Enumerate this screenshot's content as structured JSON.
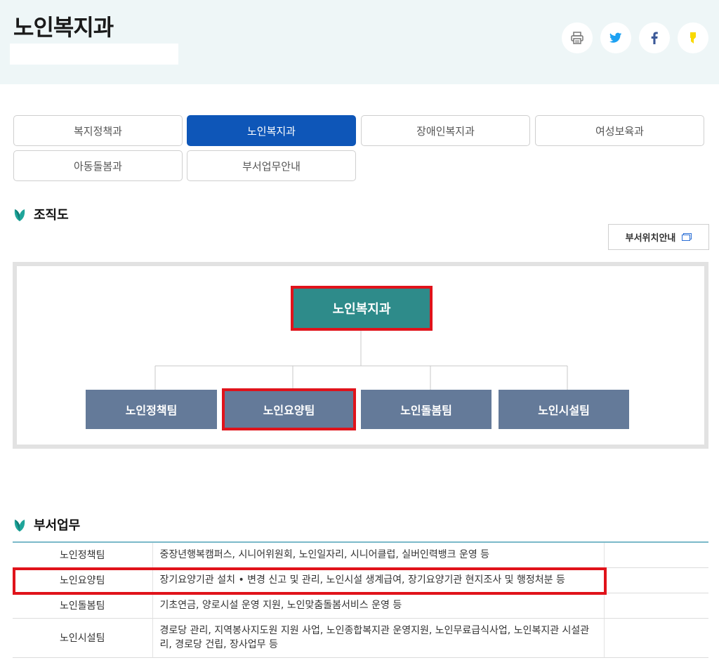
{
  "header": {
    "title": "노인복지과",
    "share_buttons": [
      {
        "icon": "print-icon",
        "color": "#777777"
      },
      {
        "icon": "twitter-icon",
        "color": "#1da1f2"
      },
      {
        "icon": "facebook-icon",
        "color": "#3b5998"
      },
      {
        "icon": "kakaostory-icon",
        "color": "#f9d900"
      }
    ]
  },
  "tabs": [
    {
      "label": "복지정책과",
      "active": false
    },
    {
      "label": "노인복지과",
      "active": true
    },
    {
      "label": "장애인복지과",
      "active": false
    },
    {
      "label": "여성보육과",
      "active": false
    },
    {
      "label": "아동돌봄과",
      "active": false
    },
    {
      "label": "부서업무안내",
      "active": false
    }
  ],
  "org_section": {
    "title": "조직도",
    "location_button": "부서위치안내",
    "root": "노인복지과",
    "teams": [
      "노인정책팀",
      "노인요양팀",
      "노인돌봄팀",
      "노인시설팀"
    ]
  },
  "duty_section": {
    "title": "부서업무",
    "rows": [
      {
        "team": "노인정책팀",
        "duty": "중장년행복캠퍼스, 시니어위원회, 노인일자리, 시니어클럽, 실버인력뱅크 운영 등"
      },
      {
        "team": "노인요양팀",
        "duty": "장기요양기관 설치 • 변경 신고 및 관리, 노인시설 생계급여, 장기요양기관 현지조사 및 행정처분 등"
      },
      {
        "team": "노인돌봄팀",
        "duty": "기초연금, 양로시설 운영 지원, 노인맞춤돌봄서비스 운영 등"
      },
      {
        "team": "노인시설팀",
        "duty": "경로당 관리, 지역봉사지도원 지원 사업, 노인종합복지관 운영지원, 노인무료급식사업, 노인복지관 시설관리, 경로당 건립, 장사업무 등"
      }
    ]
  },
  "colors": {
    "accent": "#0e56b8",
    "root_node": "#2e8b8a",
    "team_node": "#647a99",
    "highlight": "#e0131b",
    "leaf": "#1fa59a"
  }
}
